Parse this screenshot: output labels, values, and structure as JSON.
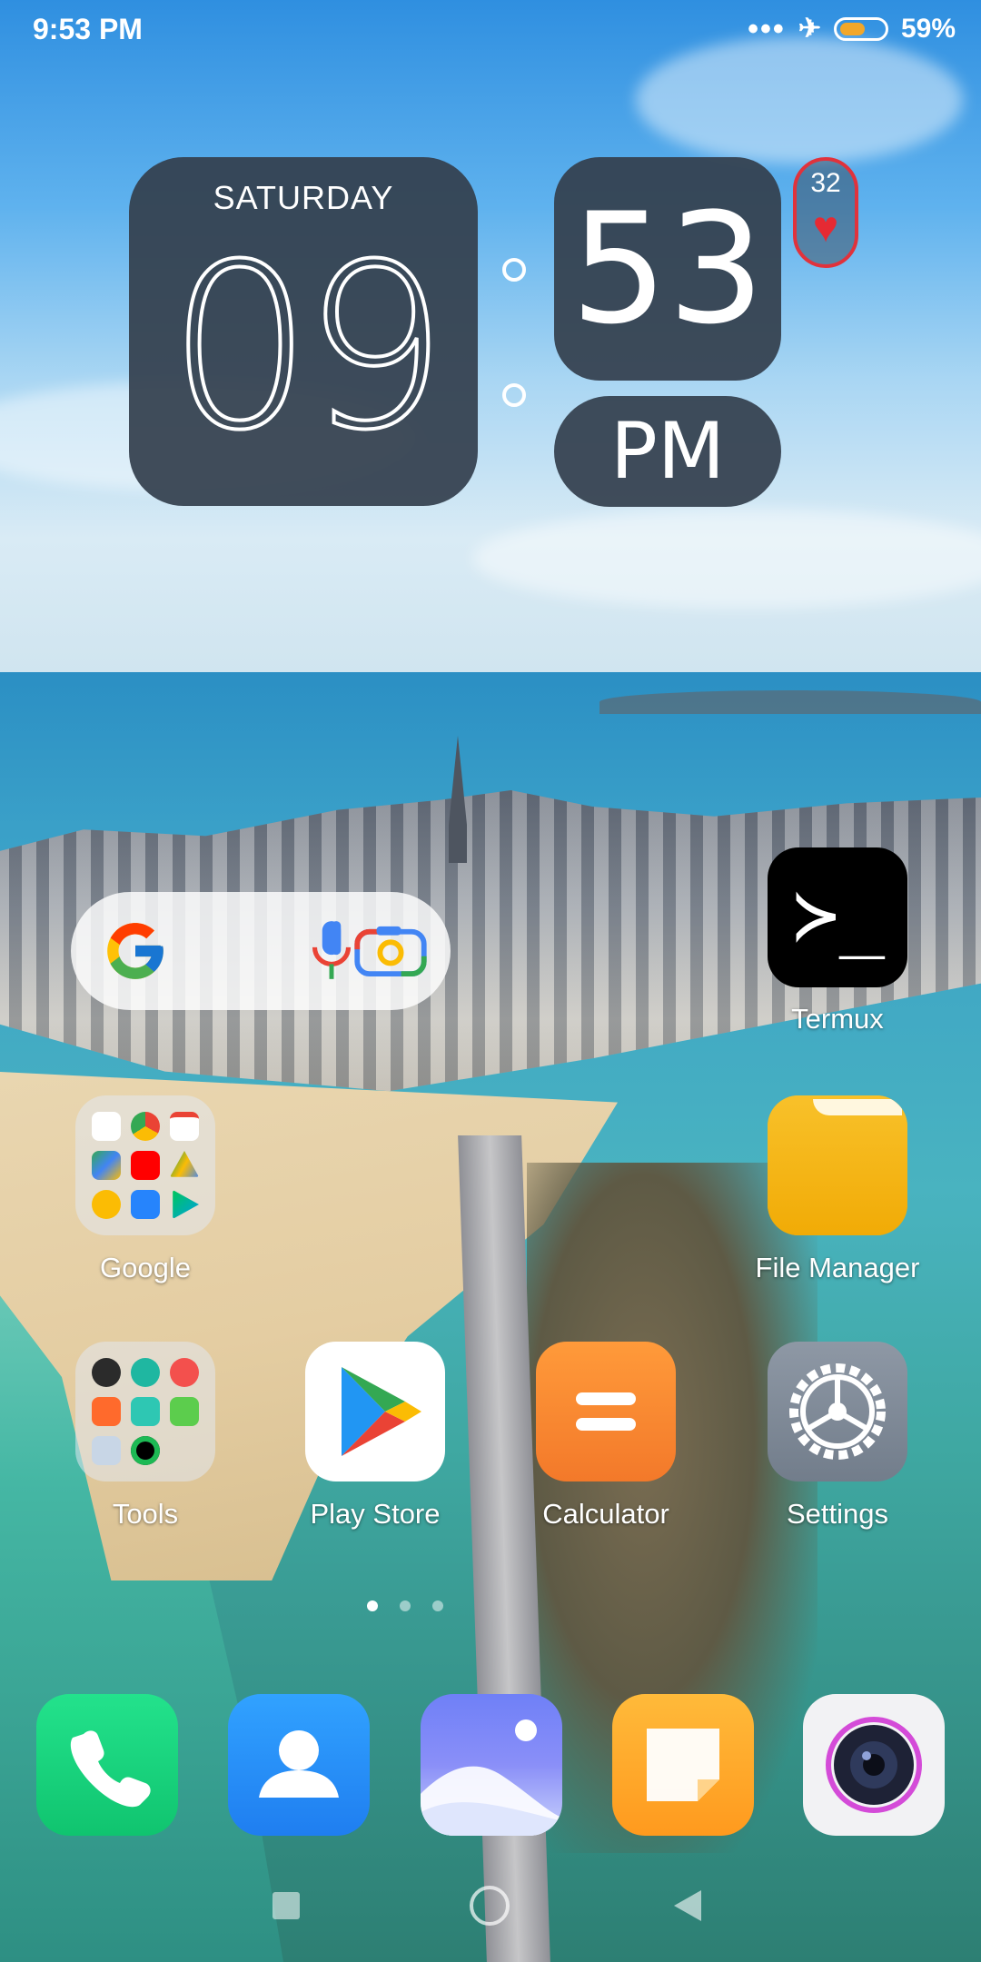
{
  "status_bar": {
    "time": "9:53 PM",
    "signal_dots": "•••",
    "airplane_icon": "✈",
    "battery_percent": "59%",
    "battery_level": 0.59
  },
  "clock_widget": {
    "day": "SATURDAY",
    "hour": "09",
    "minute": "53",
    "ampm": "PM",
    "heart_rate": "32",
    "heart_symbol": "♥"
  },
  "search_widget": {
    "icons": [
      "google-logo-icon",
      "microphone-icon",
      "google-lens-icon"
    ]
  },
  "apps": {
    "termux": {
      "label": "Termux",
      "glyph": "≻_"
    },
    "google_folder": {
      "label": "Google"
    },
    "file_manager": {
      "label": "File Manager"
    },
    "tools_folder": {
      "label": "Tools"
    },
    "play_store": {
      "label": "Play Store"
    },
    "calculator": {
      "label": "Calculator"
    },
    "settings": {
      "label": "Settings"
    }
  },
  "dock": [
    "phone-icon",
    "contacts-icon",
    "gallery-icon",
    "notes-icon",
    "camera-icon"
  ],
  "page_indicator": {
    "pages": 3,
    "active": 0
  },
  "colors": {
    "widget_bg": "#343f4d",
    "heart": "#e62a33",
    "battery_fill": "#f2a72a"
  }
}
